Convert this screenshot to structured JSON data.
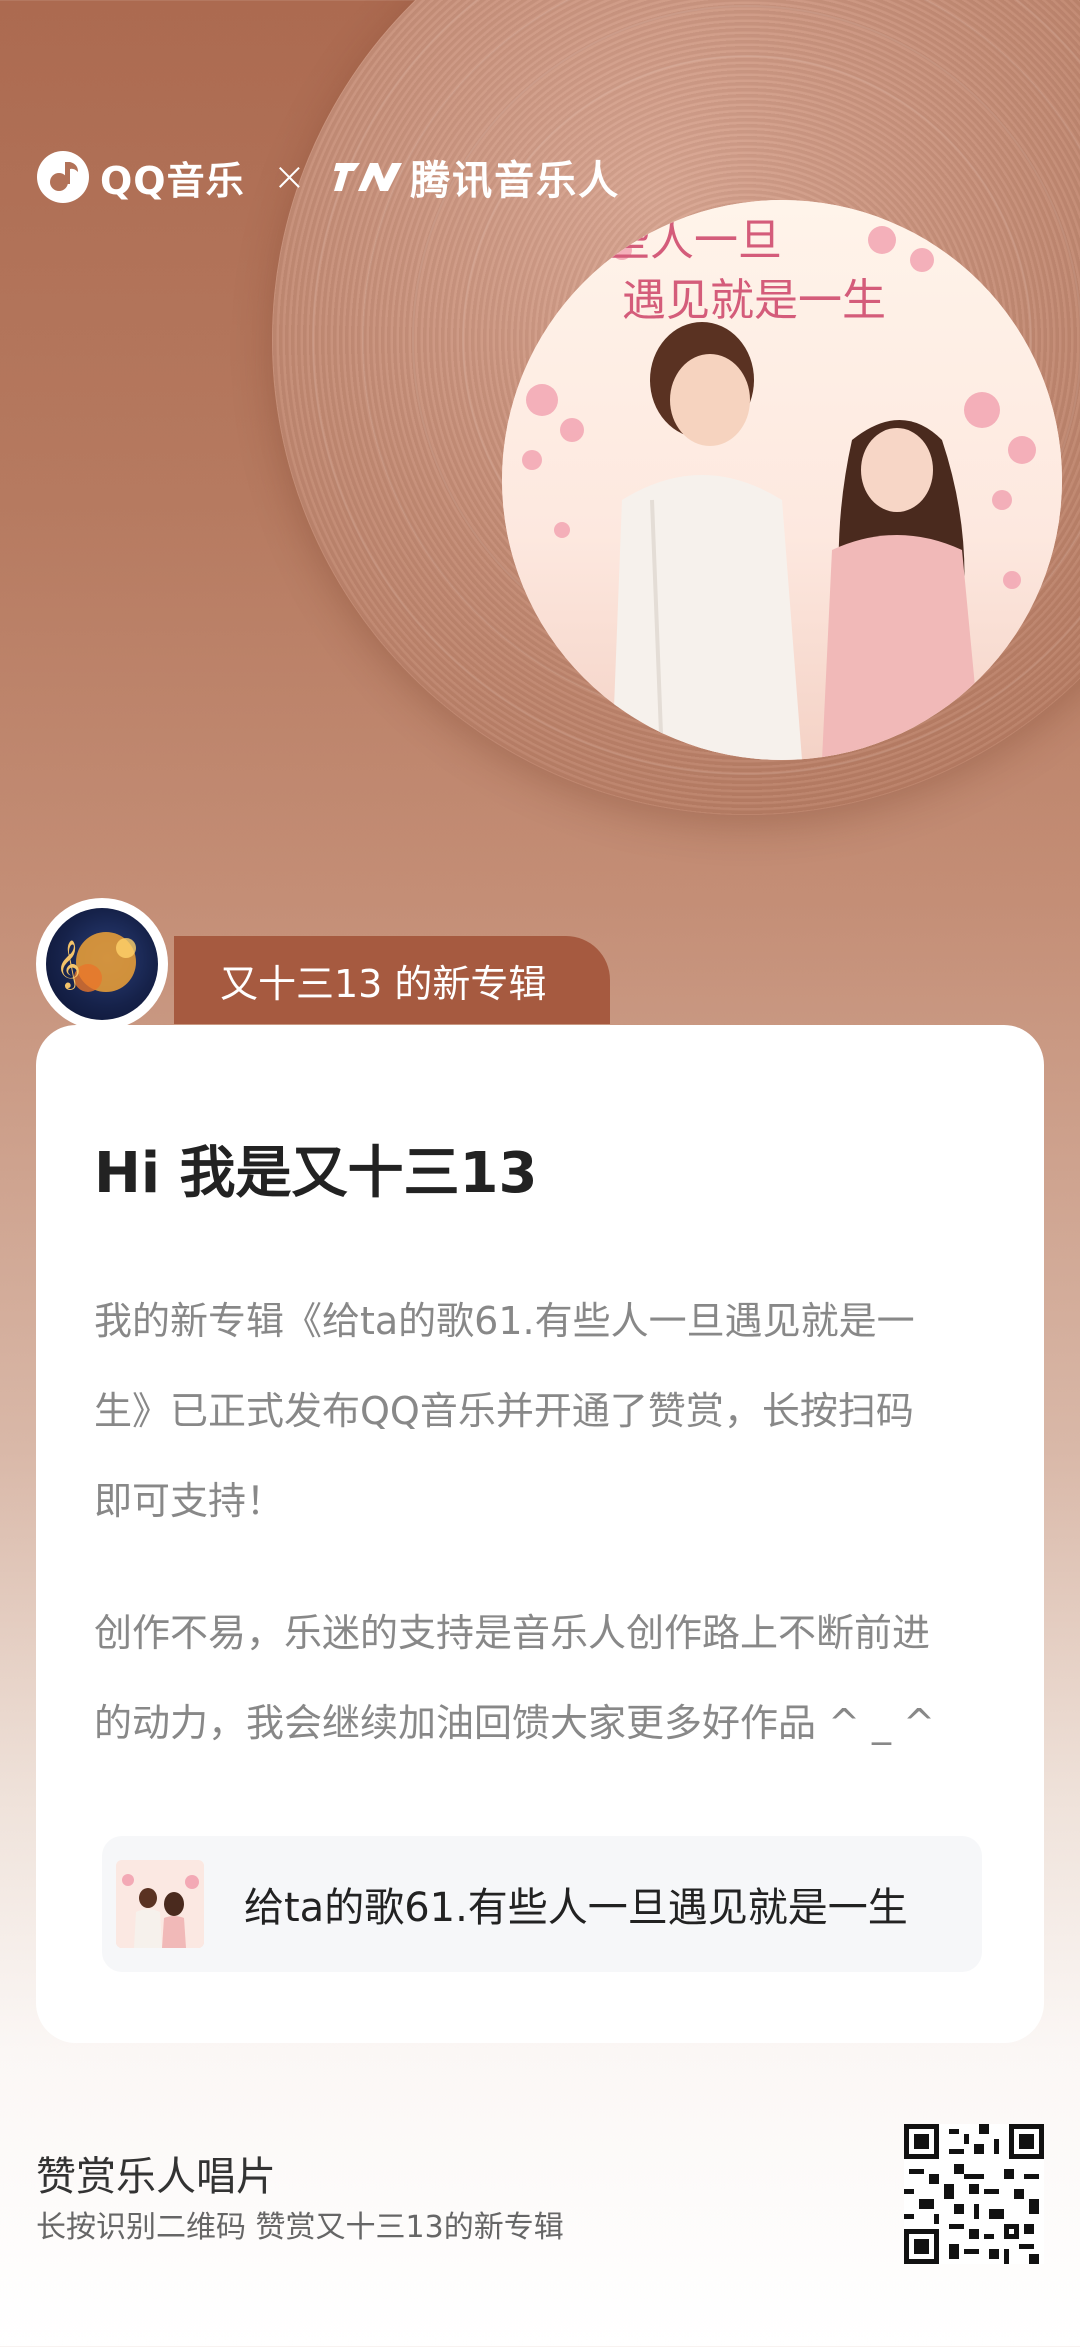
{
  "header": {
    "qq_music_label": "QQ音乐",
    "times": "×",
    "tme_label": "腾讯音乐人"
  },
  "album_art": {
    "title_line1": "有些人一旦",
    "title_line2": "遇见就是一生"
  },
  "artist_tag": "又十三13 的新专辑",
  "card": {
    "title": "Hi 我是又十三13",
    "paragraph_1_lines": [
      "我的新专辑《给ta的歌61.有些人一旦遇见就是一",
      "生》已正式发布QQ音乐并开通了赞赏，长按扫码",
      "即可支持！"
    ],
    "paragraph_2_lines": [
      "创作不易，乐迷的支持是音乐人创作路上不断前进",
      "的动力，我会继续加油回馈大家更多好作品 ^ _ ^"
    ],
    "album_name": "给ta的歌61.有些人一旦遇见就是一生"
  },
  "footer": {
    "title": "赞赏乐人唱片",
    "subtitle": "长按识别二维码 赞赏又十三13的新专辑"
  },
  "colors": {
    "background_top": "#ac6a50",
    "tag_bg": "#a65a40",
    "card_bg": "#ffffff",
    "album_box_bg": "#f6f7f9"
  },
  "icons": [
    "qq-music-logo-icon",
    "tme-logo-icon",
    "qr-code-icon"
  ]
}
